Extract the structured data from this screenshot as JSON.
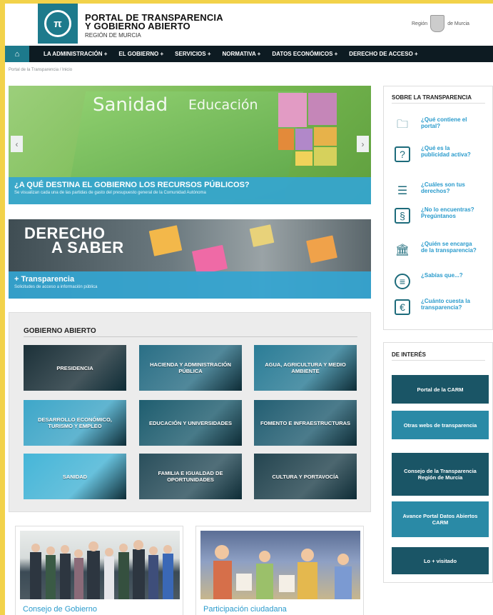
{
  "header": {
    "brand_line1": "PORTAL DE TRANSPARENCIA",
    "brand_line2": "Y GOBIERNO ABIERTO",
    "brand_line3": "REGIÓN DE MURCIA",
    "region_left": "Región",
    "region_right": "de Murcia"
  },
  "nav": {
    "items": [
      {
        "label": "LA ADMINISTRACIÓN +"
      },
      {
        "label": "EL GOBIERNO +"
      },
      {
        "label": "SERVICIOS +"
      },
      {
        "label": "NORMATIVA +"
      },
      {
        "label": "DATOS ECONÓMICOS +"
      },
      {
        "label": "DERECHO DE ACCESO +"
      }
    ]
  },
  "breadcrumb": "Portal de la Transparencia  /  Inicio",
  "hero": {
    "word1": "Sanidad",
    "word2": "Educación",
    "title": "¿A QUÉ DESTINA EL GOBIERNO LOS RECURSOS PÚBLICOS?",
    "subtitle": "Se visualizan cada una de las partidas de gasto del presupuesto general de la Comunidad Autónoma"
  },
  "derecho": {
    "line1": "DERECHO",
    "line2": "A SABER",
    "title": "+ Transparencia",
    "subtitle": "Solicitudes de acceso a información pública"
  },
  "gobierno": {
    "title": "GOBIERNO ABIERTO",
    "tiles": [
      {
        "label": "PRESIDENCIA",
        "color": "#1c3139"
      },
      {
        "label": "HACIENDA Y ADMINISTRACIÓN PÚBLICA",
        "color": "#2a6f86"
      },
      {
        "label": "AGUA, AGRICULTURA Y MEDIO AMBIENTE",
        "color": "#2b7d97"
      },
      {
        "label": "DESARROLLO ECONÓMICO, TURISMO Y EMPLEO",
        "color": "#3ea7c9"
      },
      {
        "label": "EDUCACIÓN Y UNIVERSIDADES",
        "color": "#1f5e70"
      },
      {
        "label": "FOMENTO E INFRAESTRUCTURAS",
        "color": "#235f73"
      },
      {
        "label": "SANIDAD",
        "color": "#46b6d8"
      },
      {
        "label": "FAMILIA E IGUALDAD DE OPORTUNIDADES",
        "color": "#2a4f5c"
      },
      {
        "label": "CULTURA Y PORTAVOCÍA",
        "color": "#244550"
      }
    ]
  },
  "cards": [
    {
      "label": "Consejo de Gobierno"
    },
    {
      "label": "Participación ciudadana"
    }
  ],
  "sobre": {
    "title": "SOBRE LA TRANSPARENCIA",
    "items": [
      {
        "label": "¿Qué contiene el portal?",
        "icon": "folder-icon"
      },
      {
        "label": "¿Qué es la publicidad activa?",
        "icon": "document-question-icon"
      },
      {
        "label": "¿Cuáles son tus derechos?",
        "icon": "list-icon"
      },
      {
        "label": "¿No lo encuentras? Pregúntanos",
        "icon": "question-doc-icon"
      },
      {
        "label": "¿Quién se encarga de la transparencia?",
        "icon": "institution-icon"
      },
      {
        "label": "¿Sabías que...?",
        "icon": "chat-icon"
      },
      {
        "label": "¿Cuánto cuesta la transparencia?",
        "icon": "cost-document-icon"
      }
    ]
  },
  "interes": {
    "title": "DE INTERÉS",
    "buttons": [
      {
        "label": "Portal de la CARM",
        "color": "#1a5566"
      },
      {
        "label": "Otras webs de transparencia",
        "color": "#2a8aa6"
      },
      {
        "label": "Consejo de la Transparencia Región de Murcia",
        "color": "#1a5566"
      },
      {
        "label": "Avance Portal Datos Abiertos CARM",
        "color": "#2a8aa6"
      },
      {
        "label": "Lo + visitado",
        "color": "#1a5566"
      }
    ]
  }
}
